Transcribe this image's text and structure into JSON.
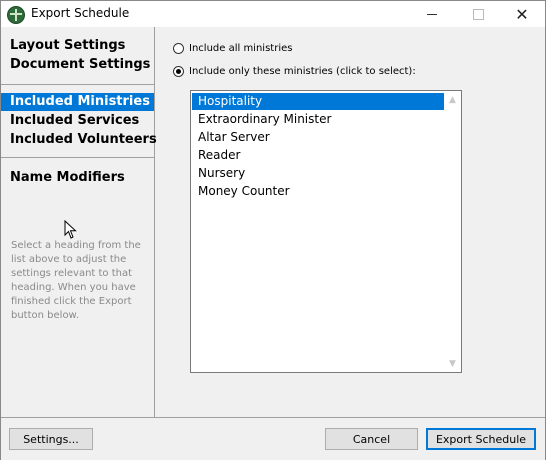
{
  "window": {
    "title": "Export Schedule"
  },
  "nav": {
    "items": [
      {
        "label": "Layout Settings"
      },
      {
        "label": "Document Settings"
      },
      {
        "label": "Included Ministries"
      },
      {
        "label": "Included Services"
      },
      {
        "label": "Included Volunteers"
      },
      {
        "label": "Name Modifiers"
      }
    ],
    "selected": "Included Ministries",
    "help_text": "Select a heading from the list above to adjust the settings relevant to that heading. When you have finished click the Export button below."
  },
  "ministries": {
    "option_all": "Include all ministries",
    "option_only": "Include only these ministries (click to select):",
    "selected_option": "only",
    "items": [
      {
        "label": "Hospitality",
        "selected": true
      },
      {
        "label": "Extraordinary Minister",
        "selected": false
      },
      {
        "label": "Altar Server",
        "selected": false
      },
      {
        "label": "Reader",
        "selected": false
      },
      {
        "label": "Nursery",
        "selected": false
      },
      {
        "label": "Money Counter",
        "selected": false
      }
    ]
  },
  "buttons": {
    "settings": "Settings...",
    "cancel": "Cancel",
    "export": "Export Schedule"
  },
  "colors": {
    "accent": "#0078d7",
    "pane_bg": "#f0f0f0"
  }
}
